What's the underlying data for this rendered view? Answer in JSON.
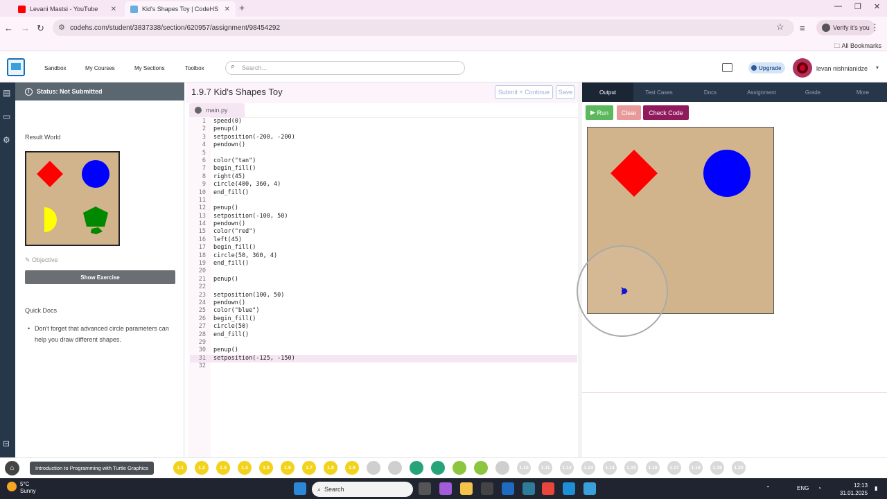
{
  "browser": {
    "tabs": [
      {
        "title": "Levani Mastsi - YouTube",
        "favicon_color": "#ff0000"
      },
      {
        "title": "Kid's Shapes Toy | CodeHS",
        "favicon_color": "#6aaee0"
      }
    ],
    "url": "codehs.com/student/3837338/section/620957/assignment/98454292",
    "verify_label": "Verify it's you",
    "bookmarks_label": "All Bookmarks"
  },
  "header": {
    "nav": [
      "Sandbox",
      "My Courses",
      "My Sections",
      "Toolbox"
    ],
    "search_placeholder": "Search...",
    "upgrade_label": "Upgrade",
    "username": "levan nishnianidze"
  },
  "left_panel": {
    "status": "Status: Not Submitted",
    "result_world_label": "Result World",
    "objective_label": "Objective",
    "show_exercise_label": "Show Exercise",
    "quick_docs_label": "Quick Docs",
    "quick_doc_item": "Don't forget that advanced circle parameters can help you draw different shapes."
  },
  "editor": {
    "title": "1.9.7 Kid's Shapes Toy",
    "submit_label": "Submit + Continue",
    "save_label": "Save",
    "file_tab": "main.py",
    "active_line": 31,
    "lines": [
      "speed(0)",
      "penup()",
      "setposition(-200, -200)",
      "pendown()",
      "",
      "color(\"tan\")",
      "begin_fill()",
      "right(45)",
      "circle(400, 360, 4)",
      "end_fill()",
      "",
      "penup()",
      "setposition(-100, 50)",
      "pendown()",
      "color(\"red\")",
      "left(45)",
      "begin_fill()",
      "circle(50, 360, 4)",
      "end_fill()",
      "",
      "penup()",
      "",
      "setposition(100, 50)",
      "pendown()",
      "color(\"blue\")",
      "begin_fill()",
      "circle(50)",
      "end_fill()",
      "",
      "penup()",
      "setposition(-125, -150)",
      ""
    ]
  },
  "output": {
    "tabs": [
      "Output",
      "Test Cases",
      "Docs",
      "Assignment",
      "Grade",
      "More"
    ],
    "run_label": "Run",
    "clear_label": "Clear",
    "check_label": "Check Code"
  },
  "course_bar": {
    "course_name": "Introduction to Programming with Turtle Graphics",
    "pills": [
      {
        "label": "1.1",
        "color": "#f2d21b"
      },
      {
        "label": "1.2",
        "color": "#f2d21b"
      },
      {
        "label": "1.3",
        "color": "#f2d21b"
      },
      {
        "label": "1.4",
        "color": "#f2d21b"
      },
      {
        "label": "1.5",
        "color": "#f2d21b"
      },
      {
        "label": "1.6",
        "color": "#f2d21b"
      },
      {
        "label": "1.7",
        "color": "#f2d21b"
      },
      {
        "label": "1.8",
        "color": "#f2d21b"
      },
      {
        "label": "1.9",
        "color": "#f2d21b"
      },
      {
        "label": "",
        "color": "#cfcfcf"
      },
      {
        "label": "",
        "color": "#cfcfcf"
      },
      {
        "label": "",
        "color": "#27a37a"
      },
      {
        "label": "",
        "color": "#27a37a"
      },
      {
        "label": "",
        "color": "#8cc63f"
      },
      {
        "label": "",
        "color": "#8cc63f"
      },
      {
        "label": "",
        "color": "#cfcfcf"
      },
      {
        "label": "1.10",
        "color": "#d9d9d9"
      },
      {
        "label": "1.11",
        "color": "#d9d9d9"
      },
      {
        "label": "1.12",
        "color": "#d9d9d9"
      },
      {
        "label": "1.13",
        "color": "#d9d9d9"
      },
      {
        "label": "1.14",
        "color": "#d9d9d9"
      },
      {
        "label": "1.15",
        "color": "#d9d9d9"
      },
      {
        "label": "1.16",
        "color": "#d9d9d9"
      },
      {
        "label": "1.17",
        "color": "#d9d9d9"
      },
      {
        "label": "1.18",
        "color": "#d9d9d9"
      },
      {
        "label": "1.19",
        "color": "#d9d9d9"
      },
      {
        "label": "1.20",
        "color": "#d9d9d9"
      }
    ]
  },
  "taskbar": {
    "weather_temp": "5°C",
    "weather_desc": "Sunny",
    "search_label": "Search",
    "lang": "ENG",
    "time": "12:13",
    "date": "31.01.2025"
  }
}
